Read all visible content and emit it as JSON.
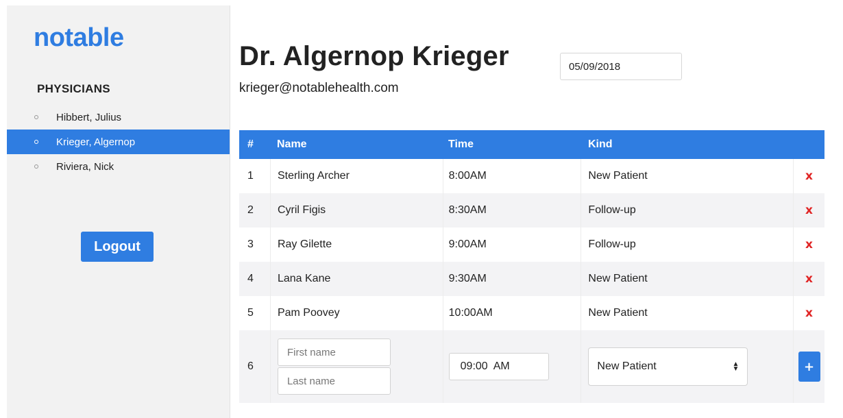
{
  "app": {
    "logo": "notable"
  },
  "sidebar": {
    "section_title": "PHYSICIANS",
    "physicians": [
      {
        "label": "Hibbert, Julius",
        "active": false
      },
      {
        "label": "Krieger, Algernop",
        "active": true
      },
      {
        "label": "Riviera, Nick",
        "active": false
      }
    ],
    "logout_label": "Logout"
  },
  "header": {
    "doctor_name": "Dr. Algernop Krieger",
    "email": "krieger@notablehealth.com",
    "date_value": "05/09/2018"
  },
  "table": {
    "columns": {
      "num": "#",
      "name": "Name",
      "time": "Time",
      "kind": "Kind"
    },
    "rows": [
      {
        "num": "1",
        "name": "Sterling Archer",
        "time": "8:00AM",
        "kind": "New Patient"
      },
      {
        "num": "2",
        "name": "Cyril Figis",
        "time": "8:30AM",
        "kind": "Follow-up"
      },
      {
        "num": "3",
        "name": "Ray Gilette",
        "time": "9:00AM",
        "kind": "Follow-up"
      },
      {
        "num": "4",
        "name": "Lana Kane",
        "time": "9:30AM",
        "kind": "New Patient"
      },
      {
        "num": "5",
        "name": "Pam Poovey",
        "time": "10:00AM",
        "kind": "New Patient"
      }
    ],
    "delete_glyph": "x",
    "new_row": {
      "num": "6",
      "first_name_placeholder": "First name",
      "last_name_placeholder": "Last name",
      "time_value": "09:00  AM",
      "kind_selected": "New Patient",
      "add_glyph": "+"
    }
  },
  "colors": {
    "accent": "#2f7de1",
    "delete": "#e02424",
    "sidebar_bg": "#f2f2f2"
  }
}
